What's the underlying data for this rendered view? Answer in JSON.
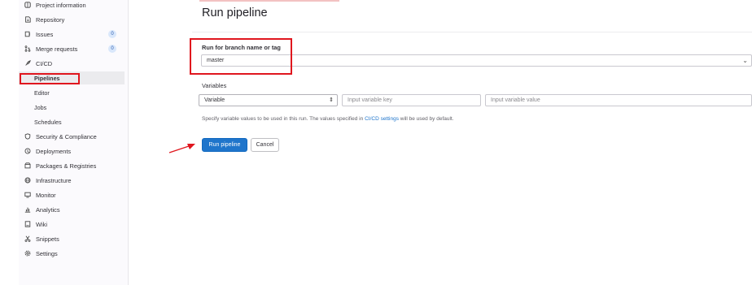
{
  "sidebar": {
    "items": [
      {
        "icon": "project-icon",
        "label": "Project information"
      },
      {
        "icon": "repository-icon",
        "label": "Repository"
      },
      {
        "icon": "issues-icon",
        "label": "Issues",
        "badge": "0"
      },
      {
        "icon": "merge-request-icon",
        "label": "Merge requests",
        "badge": "0"
      },
      {
        "icon": "rocket-icon",
        "label": "CI/CD"
      }
    ],
    "cicd_sub": [
      "Pipelines",
      "Editor",
      "Jobs",
      "Schedules"
    ],
    "items2": [
      {
        "icon": "shield-icon",
        "label": "Security & Compliance"
      },
      {
        "icon": "deployments-icon",
        "label": "Deployments"
      },
      {
        "icon": "package-icon",
        "label": "Packages & Registries"
      },
      {
        "icon": "infrastructure-icon",
        "label": "Infrastructure"
      },
      {
        "icon": "monitor-icon",
        "label": "Monitor"
      },
      {
        "icon": "analytics-icon",
        "label": "Analytics"
      },
      {
        "icon": "wiki-icon",
        "label": "Wiki"
      },
      {
        "icon": "snippets-icon",
        "label": "Snippets"
      },
      {
        "icon": "settings-icon",
        "label": "Settings"
      }
    ]
  },
  "main": {
    "title": "Run pipeline",
    "branch_label": "Run for branch name or tag",
    "branch_value": "master",
    "variables_label": "Variables",
    "variable_type": "Variable",
    "key_placeholder": "Input variable key",
    "value_placeholder": "Input variable value",
    "help_prefix": "Specify variable values to be used in this run. The values specified in ",
    "help_link": "CI/CD settings",
    "help_suffix": " will be used by default.",
    "run_button": "Run pipeline",
    "cancel_button": "Cancel"
  },
  "colors": {
    "annotation": "#e0161e",
    "primary": "#1f75cb"
  }
}
